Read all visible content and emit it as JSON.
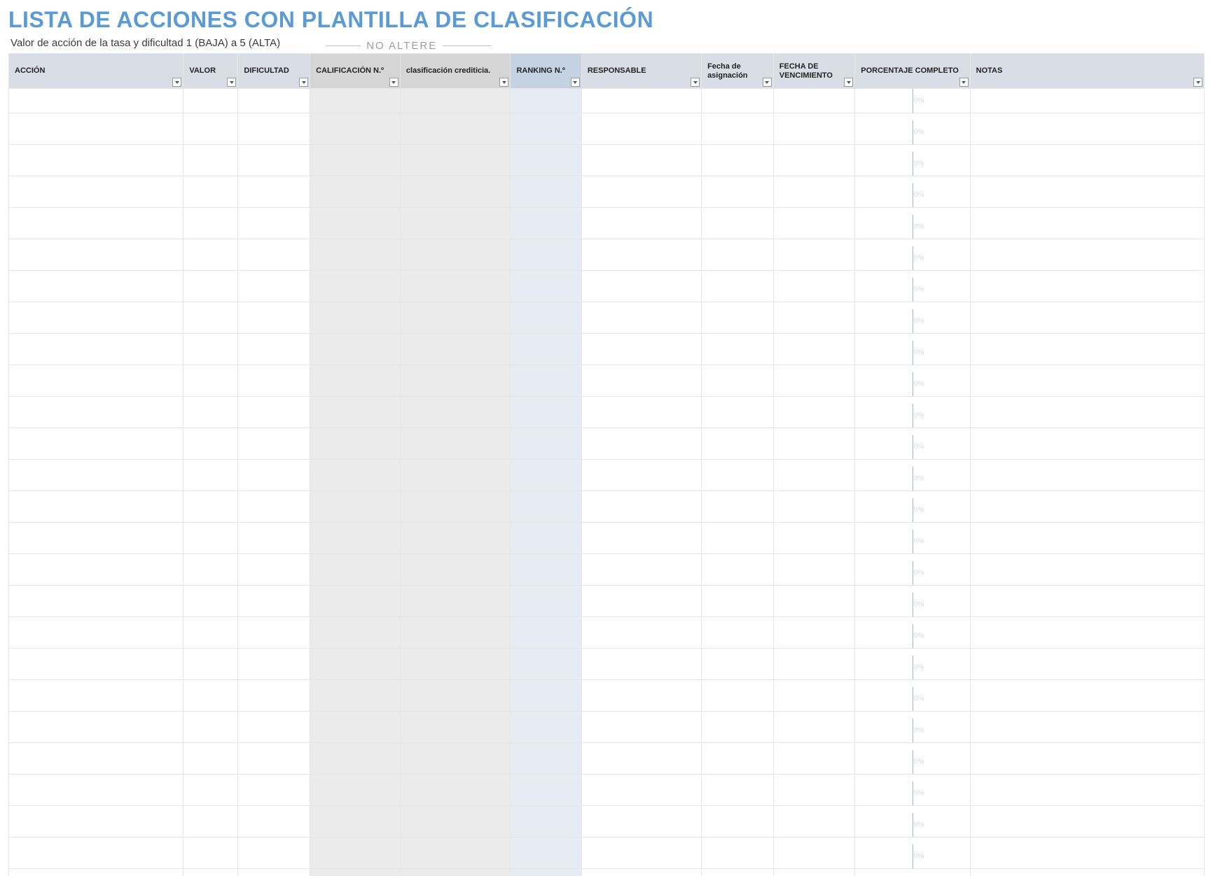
{
  "title": "LISTA DE ACCIONES CON PLANTILLA DE CLASIFICACIÓN",
  "subtitle": "Valor de acción de la tasa y dificultad 1 (BAJA) a 5 (ALTA)",
  "no_altere": "NO ALTERE",
  "columns": {
    "accion": "ACCIÓN",
    "valor": "VALOR",
    "dificultad": "DIFICULTAD",
    "calificacion": "CALIFICACIÓN N.º",
    "crediticia": "clasificación crediticia.",
    "ranking": "RANKING N.º",
    "responsable": "RESPONSABLE",
    "fecha_asignacion": "Fecha de asignación",
    "fecha_vencimiento": "FECHA DE VENCIMIENTO",
    "porcentaje": "PORCENTAJE COMPLETO",
    "notas": "NOTAS"
  },
  "pct_default": "0%",
  "row_count": 25
}
